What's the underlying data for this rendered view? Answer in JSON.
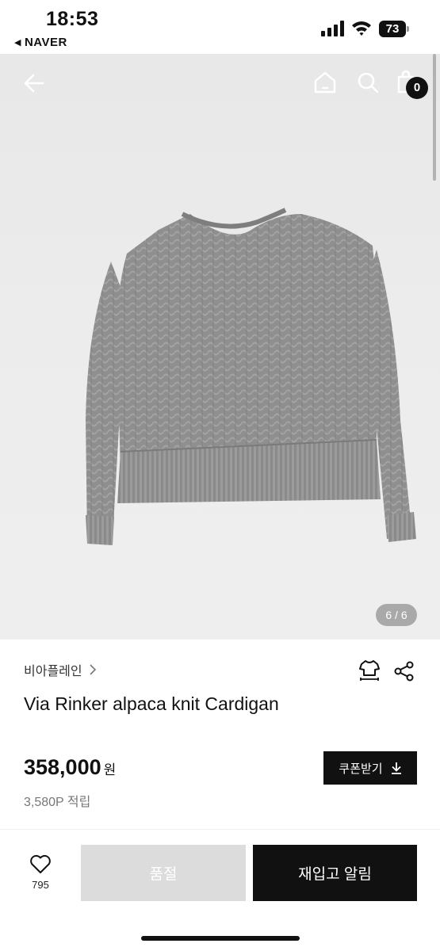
{
  "status_bar": {
    "time": "18:53",
    "back_app": "NAVER",
    "battery": "73"
  },
  "product_gallery": {
    "page_indicator": "6 / 6",
    "cart_count": "0",
    "icons": [
      "back-arrow-icon",
      "home-icon",
      "search-icon",
      "shopping-bag-icon"
    ]
  },
  "product": {
    "brand": "비아플레인",
    "title": "Via Rinker alpaca knit Cardigan",
    "price": "358,000",
    "price_unit": "원",
    "points": "3,580P 적립",
    "coupon_label": "쿠폰받기"
  },
  "bottom_bar": {
    "like_count": "795",
    "soldout_label": "품절",
    "restock_label": "재입고 알림"
  },
  "colors": {
    "primary": "#111111",
    "disabled": "#dcdcdc",
    "image_bg": "#ebebeb"
  }
}
